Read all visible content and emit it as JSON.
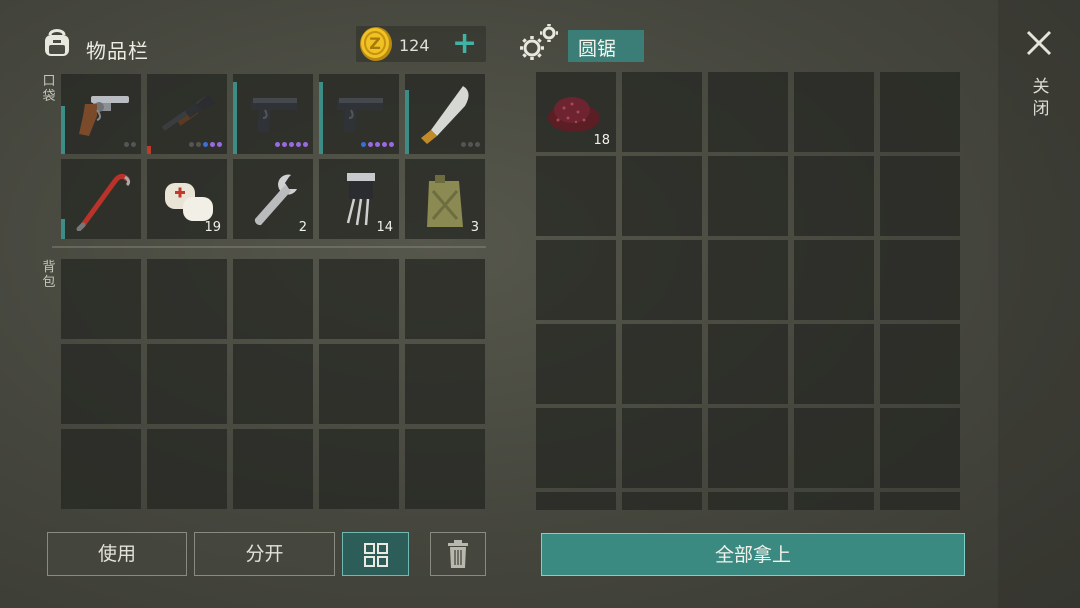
{
  "inventory": {
    "title": "物品栏",
    "coins": "124",
    "pocket_label": "口袋",
    "backpack_label": "背包",
    "pocket_slots": [
      {
        "item": "revolver",
        "count": "",
        "durability": 0.6,
        "dots": [
          "#555",
          "#555"
        ]
      },
      {
        "item": "shotgun",
        "count": "",
        "durability": 0.1,
        "dots": [
          "#555",
          "#555",
          "#3a6fd6",
          "#9a6be0",
          "#9a6be0"
        ]
      },
      {
        "item": "pistol",
        "count": "",
        "durability": 0.9,
        "dots": [
          "#9a6be0",
          "#9a6be0",
          "#9a6be0",
          "#9a6be0",
          "#9a6be0"
        ]
      },
      {
        "item": "pistol",
        "count": "",
        "durability": 0.9,
        "dots": [
          "#3a6fd6",
          "#9a6be0",
          "#9a6be0",
          "#9a6be0",
          "#9a6be0"
        ]
      },
      {
        "item": "machete",
        "count": "",
        "durability": 0.8,
        "dots": [
          "#555",
          "#555",
          "#555"
        ]
      },
      {
        "item": "crowbar",
        "count": "",
        "durability": 0.25,
        "dots": []
      },
      {
        "item": "bandage",
        "count": "19",
        "durability": 0,
        "dots": []
      },
      {
        "item": "wrench",
        "count": "2",
        "durability": 0,
        "dots": []
      },
      {
        "item": "transistor",
        "count": "14",
        "durability": 0,
        "dots": []
      },
      {
        "item": "jerrycan",
        "count": "3",
        "durability": 0,
        "dots": []
      }
    ]
  },
  "crafting": {
    "station_label": "圆锯",
    "slots": [
      {
        "item": "sawdust",
        "count": "18"
      }
    ]
  },
  "close_label": "关闭",
  "buttons": {
    "use": "使用",
    "split": "分开",
    "take_all": "全部拿上"
  },
  "colors": {
    "accent": "#3fb3a4",
    "bar": "#3e8c86",
    "low_durability": "#c0392b",
    "slot_bg": "#25261f"
  },
  "icons": {
    "bag": "backpack-icon",
    "coin": "coin-icon",
    "plus": "plus-icon",
    "gears": "gears-icon",
    "close": "close-icon",
    "grid": "grid-icon",
    "trash": "trash-icon"
  }
}
